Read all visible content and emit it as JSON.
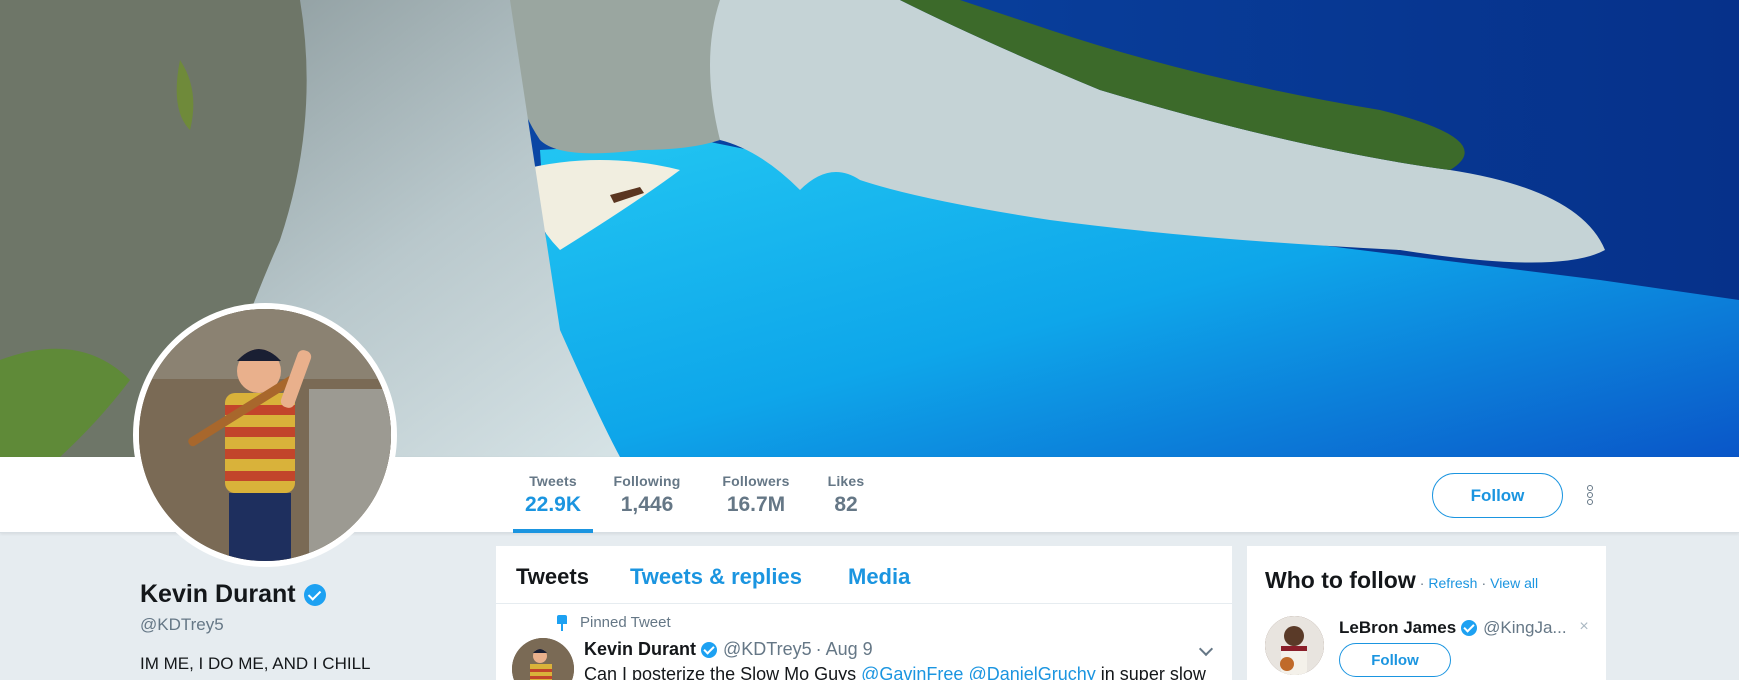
{
  "profile": {
    "name": "Kevin Durant",
    "handle": "@KDTrey5",
    "bio": "IM ME, I DO ME, AND I CHILL"
  },
  "stats": [
    {
      "label": "Tweets",
      "value": "22.9K"
    },
    {
      "label": "Following",
      "value": "1,446"
    },
    {
      "label": "Followers",
      "value": "16.7M"
    },
    {
      "label": "Likes",
      "value": "82"
    }
  ],
  "actions": {
    "follow_label": "Follow"
  },
  "timeline": {
    "tabs": [
      "Tweets",
      "Tweets & replies",
      "Media"
    ],
    "pinned_label": "Pinned Tweet",
    "tweet": {
      "name": "Kevin Durant",
      "handle": "@KDTrey5",
      "sep": "·",
      "date": "Aug 9",
      "text_start": "Can I posterize the Slow Mo Guys ",
      "mention1": "@GavinFree",
      "mention2": "@DanielGruchy",
      "text_end": " in super slow"
    }
  },
  "who_to_follow": {
    "title": "Who to follow",
    "sep": "·",
    "refresh": "Refresh",
    "view_all": "View all",
    "suggestion": {
      "name": "LeBron James",
      "handle": "@KingJa...",
      "close": "×",
      "follow_label": "Follow"
    }
  },
  "colors": {
    "accent": "#1b95e0",
    "verified": "#1da1f2",
    "muted": "#657786",
    "background": "#e6ecf0"
  }
}
